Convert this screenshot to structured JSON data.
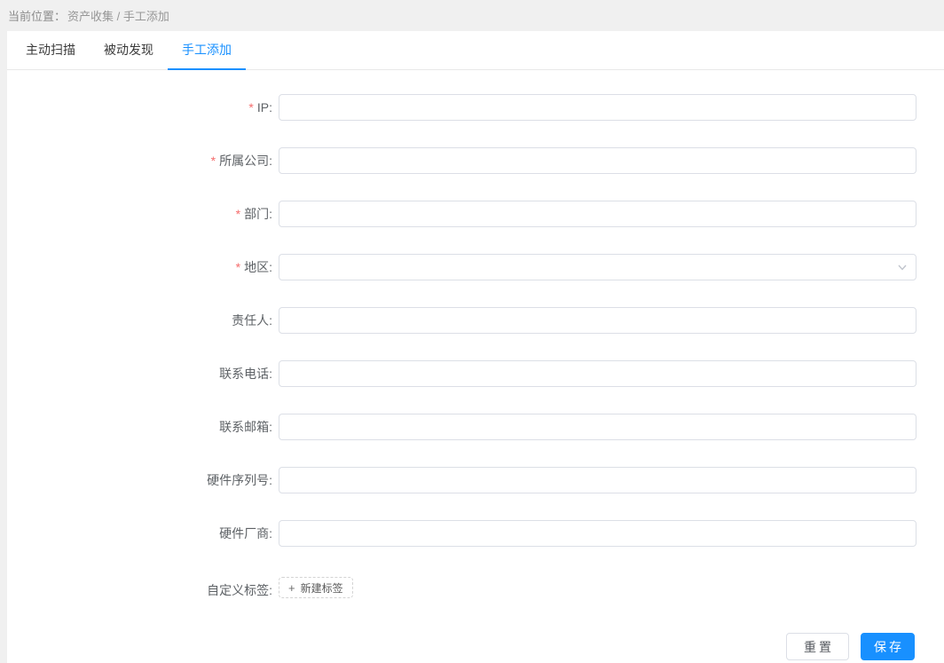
{
  "colors": {
    "primary": "#1890ff",
    "page_bg": "#f0f0f0",
    "card_bg": "#ffffff",
    "input_border": "#dcdfe6",
    "required_mark": "#f56c6c",
    "label_text": "#5e6266",
    "breadcrumb_text": "#979797"
  },
  "breadcrumb": {
    "prefix": "当前位置：",
    "path": "资产收集 / 手工添加"
  },
  "tabs": [
    {
      "label": "主动扫描",
      "active": false
    },
    {
      "label": "被动发现",
      "active": false
    },
    {
      "label": "手工添加",
      "active": true
    }
  ],
  "form": {
    "required_mark": "*",
    "label_suffix": ":",
    "fields": [
      {
        "label": "IP",
        "required": true,
        "type": "text",
        "value": "",
        "placeholder": ""
      },
      {
        "label": "所属公司",
        "required": true,
        "type": "text",
        "value": "",
        "placeholder": ""
      },
      {
        "label": "部门",
        "required": true,
        "type": "text",
        "value": "",
        "placeholder": ""
      },
      {
        "label": "地区",
        "required": true,
        "type": "select",
        "value": "",
        "placeholder": ""
      },
      {
        "label": "责任人",
        "required": false,
        "type": "text",
        "value": "",
        "placeholder": ""
      },
      {
        "label": "联系电话",
        "required": false,
        "type": "text",
        "value": "",
        "placeholder": ""
      },
      {
        "label": "联系邮箱",
        "required": false,
        "type": "text",
        "value": "",
        "placeholder": ""
      },
      {
        "label": "硬件序列号",
        "required": false,
        "type": "text",
        "value": "",
        "placeholder": ""
      },
      {
        "label": "硬件厂商",
        "required": false,
        "type": "text",
        "value": "",
        "placeholder": ""
      }
    ],
    "tags": {
      "label": "自定义标签",
      "add_button_icon": "+",
      "add_button_label": "新建标签"
    }
  },
  "actions": {
    "reset_label": "重置",
    "save_label": "保存"
  }
}
